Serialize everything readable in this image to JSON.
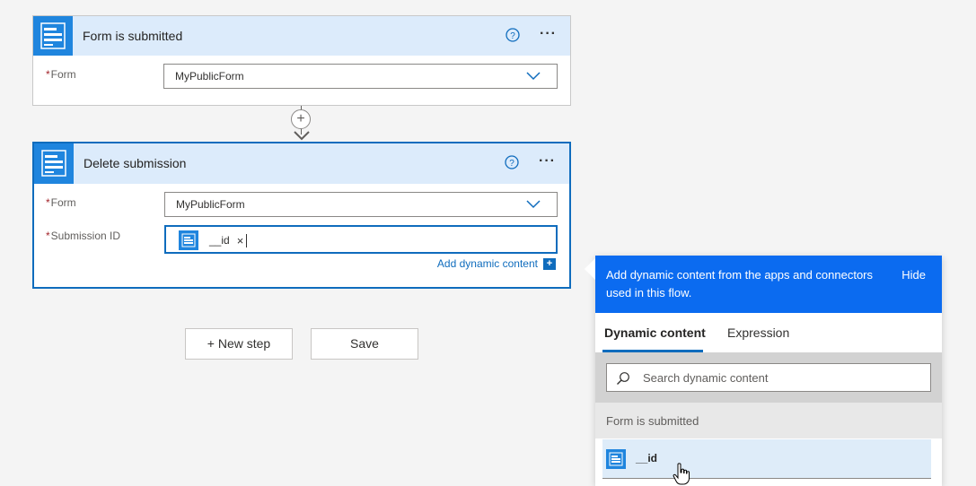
{
  "step1": {
    "title": "Form is submitted",
    "form_label": "Form",
    "required_mark": "*",
    "form_value": "MyPublicForm",
    "more": "···"
  },
  "step2": {
    "title": "Delete submission",
    "form_label": "Form",
    "required_mark": "*",
    "form_value": "MyPublicForm",
    "submission_label": "Submission ID",
    "token_text": "__id",
    "token_remove": "×",
    "add_dynamic": "Add dynamic content",
    "add_dynamic_plus": "+",
    "more": "···"
  },
  "connector": {
    "plus": "+"
  },
  "buttons": {
    "new_step": "+ New step",
    "save": "Save"
  },
  "dynamic_panel": {
    "header": "Add dynamic content from the apps and connectors used in this flow.",
    "hide": "Hide",
    "tabs": [
      "Dynamic content",
      "Expression"
    ],
    "search_placeholder": "Search dynamic content",
    "section": "Form is submitted",
    "items": [
      {
        "label": "__id",
        "icon": "form-icon"
      }
    ]
  },
  "colors": {
    "accent": "#0f6cbd",
    "header_bg": "#dcebfb",
    "panel_header": "#0b6bf0",
    "icon_bg": "#1f85de"
  }
}
